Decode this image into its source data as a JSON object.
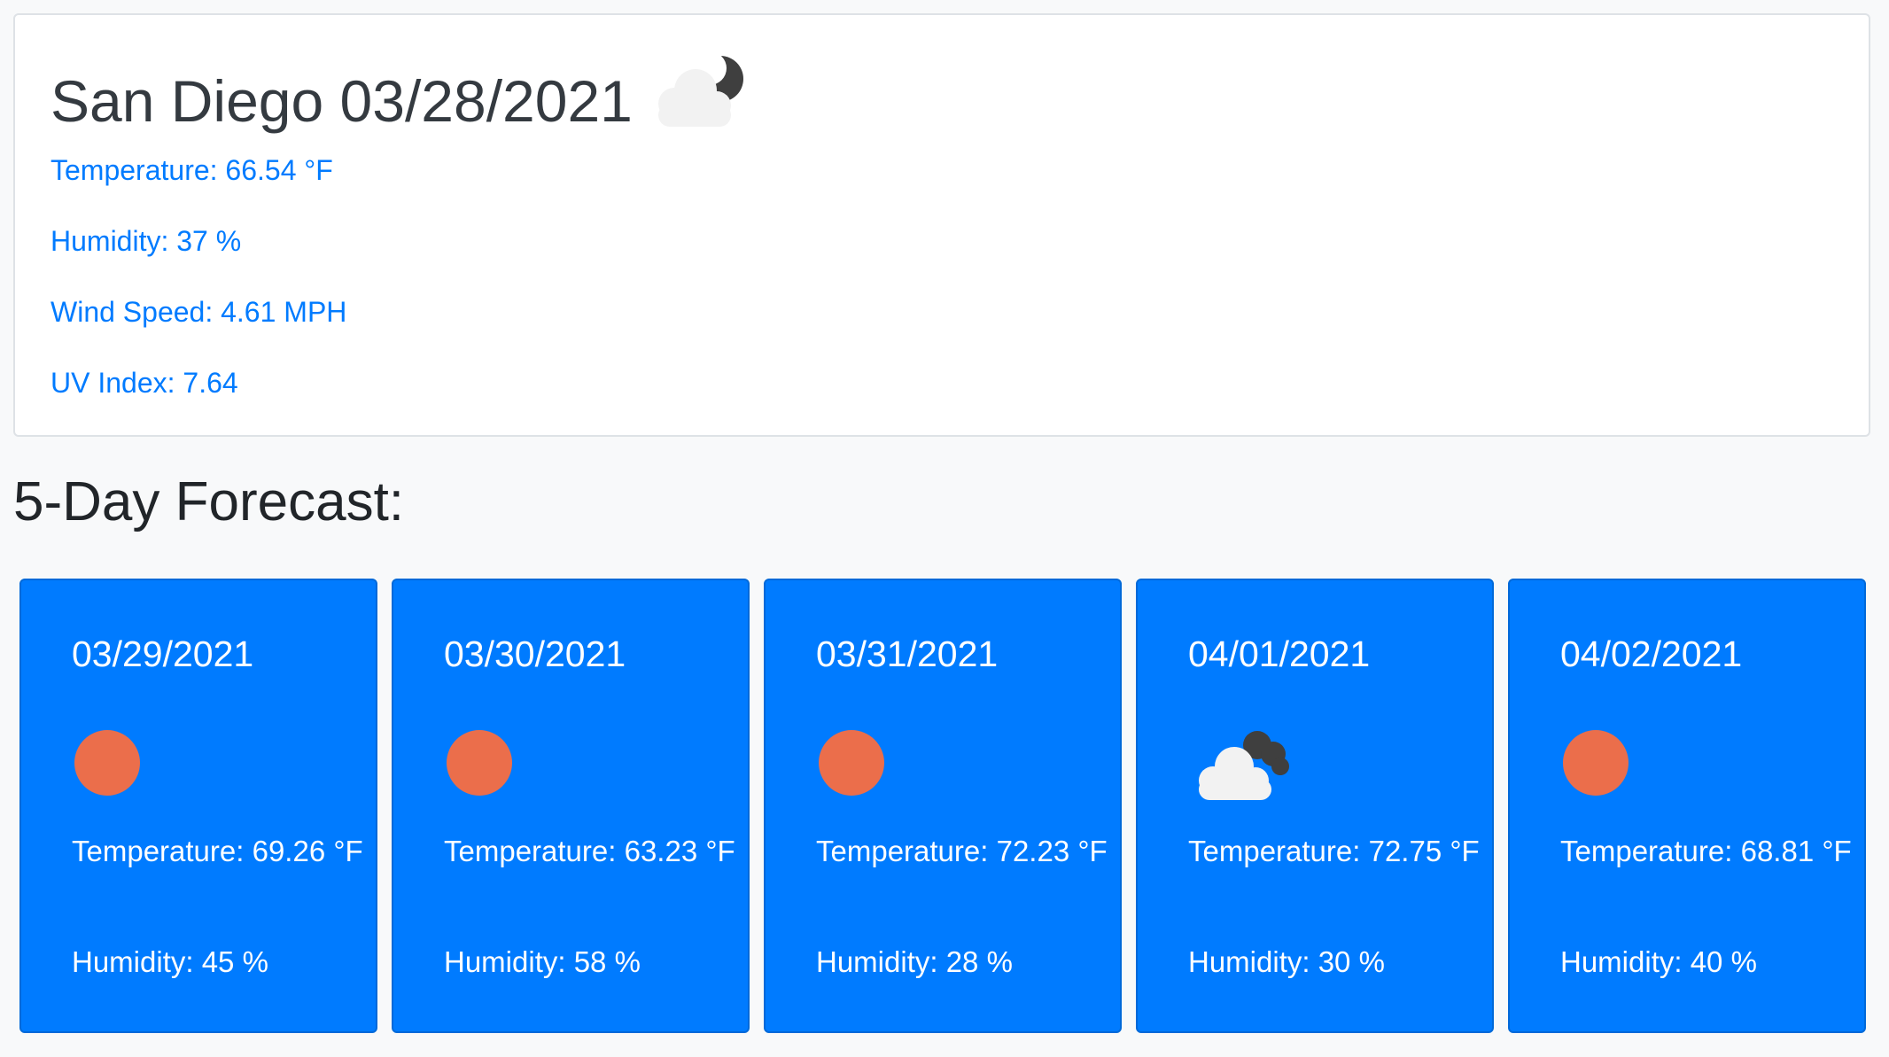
{
  "current": {
    "city": "San Diego",
    "date": "03/28/2021",
    "title": "San Diego 03/28/2021",
    "icon": "partly-cloudy-night-icon",
    "temperature": "Temperature: 66.54 °F",
    "humidity": "Humidity: 37 %",
    "wind_speed": "Wind Speed: 4.61 MPH",
    "uv_index": "UV Index: 7.64"
  },
  "forecast": {
    "heading": "5-Day Forecast:",
    "days": [
      {
        "date": "03/29/2021",
        "icon": "sun-icon",
        "temperature": "Temperature: 69.26 °F",
        "humidity": "Humidity: 45 %"
      },
      {
        "date": "03/30/2021",
        "icon": "sun-icon",
        "temperature": "Temperature: 63.23 °F",
        "humidity": "Humidity: 58 %"
      },
      {
        "date": "03/31/2021",
        "icon": "sun-icon",
        "temperature": "Temperature: 72.23 °F",
        "humidity": "Humidity: 28 %"
      },
      {
        "date": "04/01/2021",
        "icon": "clouds-icon",
        "temperature": "Temperature: 72.75 °F",
        "humidity": "Humidity: 30 %"
      },
      {
        "date": "04/02/2021",
        "icon": "sun-icon",
        "temperature": "Temperature: 68.81 °F",
        "humidity": "Humidity: 40 %"
      }
    ]
  },
  "colors": {
    "card_blue": "#007bff",
    "link_blue": "#007bff",
    "sun": "#eb6e4b",
    "cloud_light": "#f2f2f2",
    "cloud_dark": "#3f3f3f"
  }
}
